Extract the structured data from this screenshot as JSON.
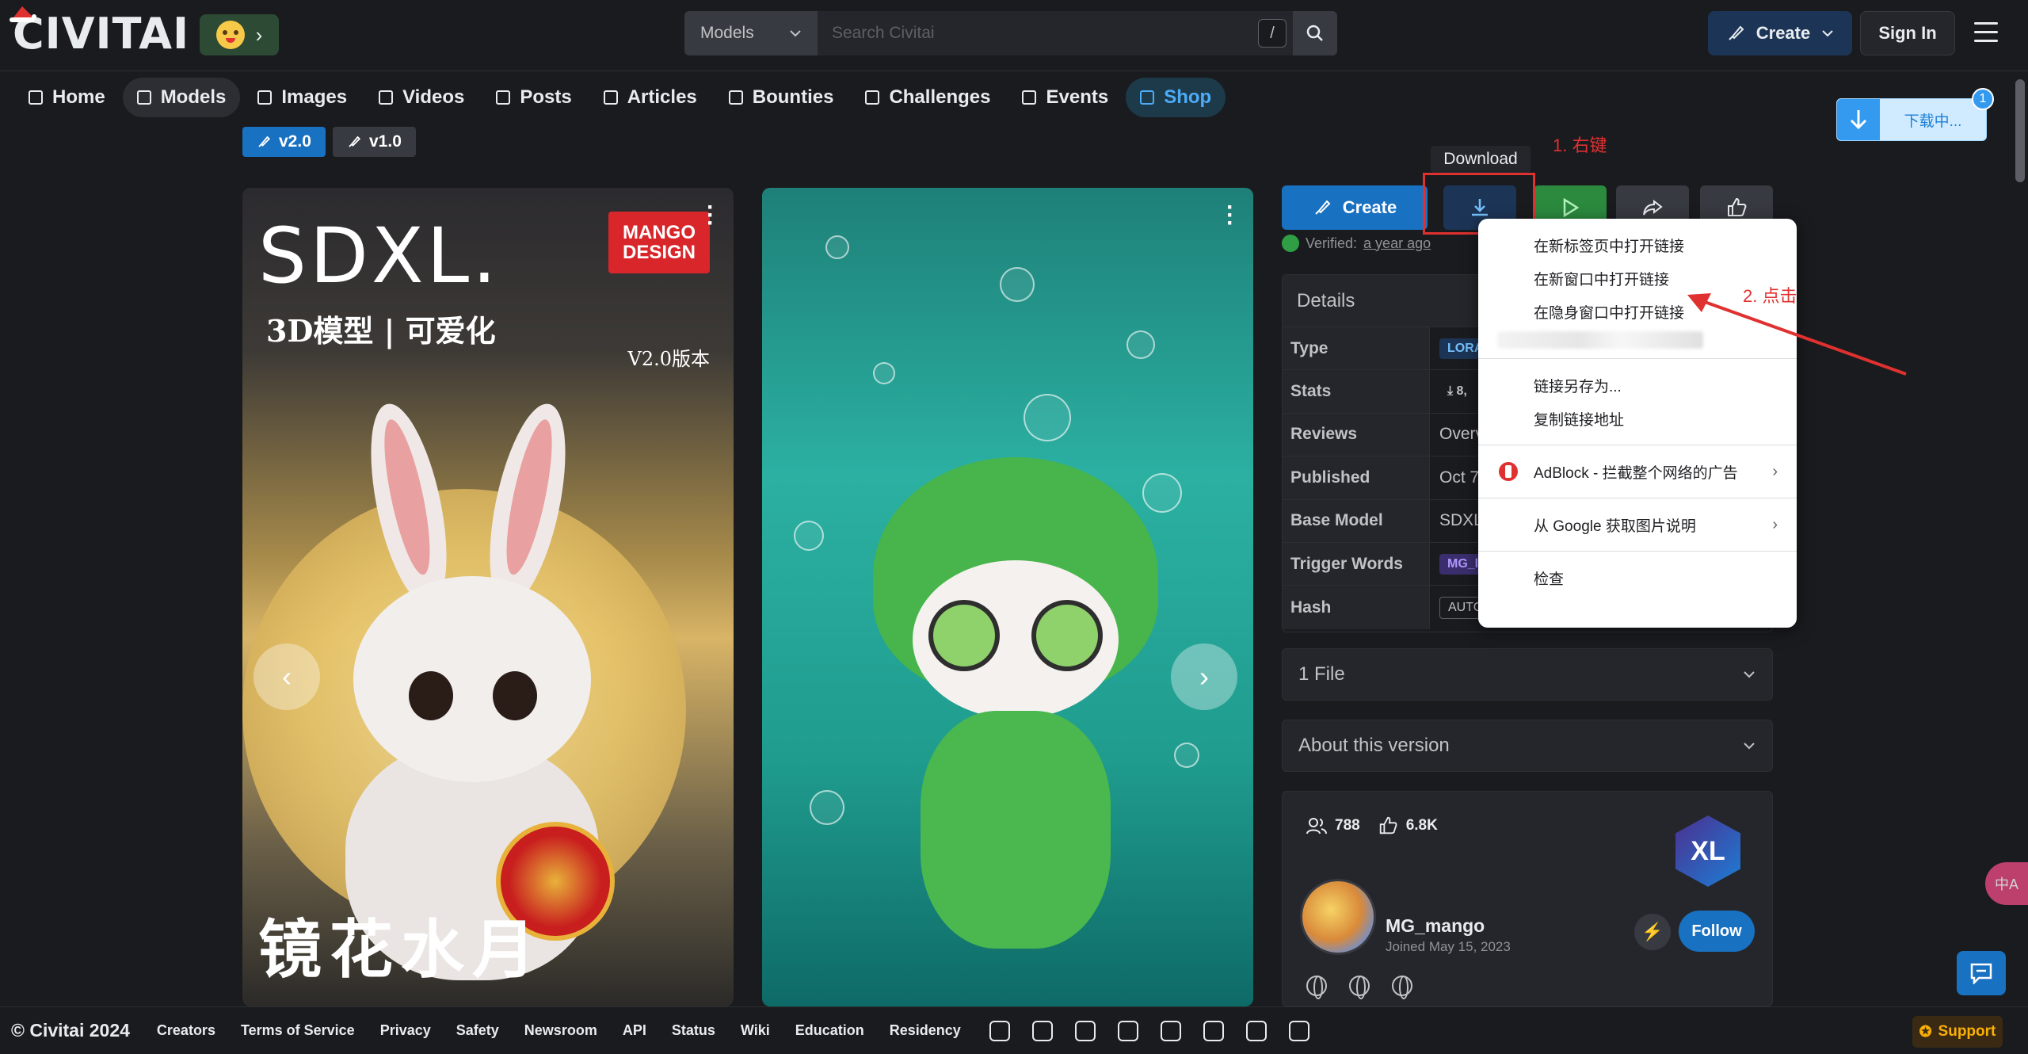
{
  "header": {
    "logo": "CIVITAI",
    "search": {
      "category": "Models",
      "placeholder": "Search Civitai",
      "shortcut": "/"
    },
    "create_label": "Create",
    "signin_label": "Sign In"
  },
  "nav": {
    "items": [
      {
        "label": "Home",
        "icon": "home-icon"
      },
      {
        "label": "Models",
        "icon": "grid-icon"
      },
      {
        "label": "Images",
        "icon": "image-icon"
      },
      {
        "label": "Videos",
        "icon": "video-icon"
      },
      {
        "label": "Posts",
        "icon": "posts-icon"
      },
      {
        "label": "Articles",
        "icon": "article-icon"
      },
      {
        "label": "Bounties",
        "icon": "bounty-icon"
      },
      {
        "label": "Challenges",
        "icon": "trophy-icon"
      },
      {
        "label": "Events",
        "icon": "calendar-icon"
      },
      {
        "label": "Shop",
        "icon": "shop-icon"
      }
    ]
  },
  "versions": [
    "v2.0",
    "v1.0"
  ],
  "poster1": {
    "title": "SDXL.",
    "badge_line1": "MANGO",
    "badge_line2": "DESIGN",
    "subtitle": "3D模型 | 可爱化",
    "version": "V2.0版本",
    "bottom_text": "镜花水月"
  },
  "actions": {
    "create_label": "Create",
    "tooltip": "Download",
    "verified_label": "Verified:",
    "verified_time": "a year ago"
  },
  "annotations": {
    "step1": "1. 右键",
    "step2": "2. 点击"
  },
  "details": {
    "title": "Details",
    "rows": [
      {
        "key": "Type",
        "value": "LORA"
      },
      {
        "key": "Stats",
        "value": "8,"
      },
      {
        "key": "Reviews",
        "value": "Overv"
      },
      {
        "key": "Published",
        "value": "Oct 7"
      },
      {
        "key": "Base Model",
        "value": "SDXL"
      },
      {
        "key": "Trigger Words",
        "value": "MG_l"
      },
      {
        "key": "Hash",
        "value": "AUTO"
      }
    ]
  },
  "accordions": {
    "files": "1 File",
    "about": "About this version"
  },
  "creator": {
    "followers": "788",
    "likes": "6.8K",
    "badge": "XL",
    "name": "MG_mango",
    "joined": "Joined May 15, 2023",
    "follow_label": "Follow"
  },
  "context_menu": {
    "items": [
      "在新标签页中打开链接",
      "在新窗口中打开链接",
      "在隐身窗口中打开链接",
      "链接另存为...",
      "复制链接地址",
      "AdBlock - 拦截整个网络的广告",
      "从 Google 获取图片说明",
      "检查"
    ]
  },
  "download_popup": {
    "text": "下载中...",
    "badge": "1"
  },
  "translate_label": "中A",
  "footer": {
    "copyright": "© Civitai 2024",
    "links": [
      "Creators",
      "Terms of Service",
      "Privacy",
      "Safety",
      "Newsroom",
      "API",
      "Status",
      "Wiki",
      "Education",
      "Residency"
    ],
    "support_label": "Support"
  },
  "colors": {
    "accent": "#1971c2",
    "background": "#1a1b1e",
    "annotation": "#e03131"
  }
}
